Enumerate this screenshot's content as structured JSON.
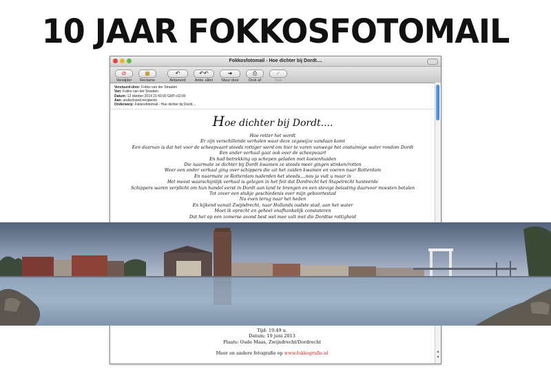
{
  "banner": {
    "title": "10 JAAR FOKKOSFOTOMAIL"
  },
  "window": {
    "title": "Fokkosfotomail - Hoe dichter bij Dordt....",
    "toolbar": [
      {
        "id": "delete",
        "label": "Verwijder",
        "icon": "delete-icon"
      },
      {
        "id": "junk",
        "label": "Reclame",
        "icon": "junk-icon"
      },
      {
        "id": "reply",
        "label": "Antwoord",
        "icon": "reply-icon"
      },
      {
        "id": "reply-all",
        "label": "Antw. allen",
        "icon": "reply-all-icon"
      },
      {
        "id": "forward",
        "label": "Stuur door",
        "icon": "forward-icon"
      },
      {
        "id": "print",
        "label": "Druk af",
        "icon": "print-icon"
      },
      {
        "id": "task",
        "label": "Taak",
        "icon": "task-icon"
      }
    ],
    "header": [
      {
        "key": "Verstuurd-door:",
        "value": "Fokko van der Straaten"
      },
      {
        "key": "Van:",
        "value": "Fokko van der Straaten"
      },
      {
        "key": "Datum:",
        "value": "12 oktober 2014 21:43:00 GMT+02:00"
      },
      {
        "key": "Aan:",
        "value": "undisclosed-recipients"
      },
      {
        "key": "Onderwerp:",
        "value": "Fokkosfotomail - Hoe dichter bij Dordt...."
      }
    ],
    "body": {
      "subject_initial": "H",
      "subject_rest": "oe dichter bij Dordt....",
      "lines": [
        "Hoe rotter het wordt",
        "Er zijn verschillende verhalen waar deze zegswijze vandaan komt",
        "Een daarvan is dat het voor de scheepvaart steeds rottiger werd om hier te varen vanwege het onstuimige water rondom Dordt",
        "Een ander verhaal gaat ook over de scheepvaart",
        "En had betrekking op schepen geladen met koeienhuiden",
        "Die naarmate ze dichter bij Dordt kwamen ze steeds meer gingen stinken/rotten",
        "Weer een ander verhaal ging over schippers die uit het zuiden kwamen en voeren naar Rotterdam",
        "En naarmate ze Rotterdam naderden het steeds....nou ja vult u maar in",
        "Het meest waarschijnlijk verhaal is gelegen in het feit dat Dordrecht het Stapelrecht hanteerde",
        "Schippers waren verplicht om hun handel eerst in Dordt aan land te brengen en een stevige belasting daarvoor moesten betalen",
        "Tot zover een stukje geschiedenis over mijn geboortestad",
        "Nu even terug naar het heden",
        "En kijkend vanuit Zwijndrecht, naar Hollands oudste stad, aan het water",
        "Moet ik oprecht en geheel onafhankelijk constateren",
        "Dat het op een zomerse avond best wel mee valt met die Dordtse rottigheid"
      ]
    },
    "footer": {
      "time": "Tijd: 19.49 u.",
      "date": "Datum: 19 juni 2013",
      "place": "Plaats: Oude Maas, Zwijndrecht/Dordrecht",
      "more_prefix": "Meer en andere fotografie op ",
      "link": "www.fokkografie.nl"
    }
  },
  "colors": {
    "link": "#c51b1b",
    "scroll_thumb": "#3f7fd4"
  }
}
